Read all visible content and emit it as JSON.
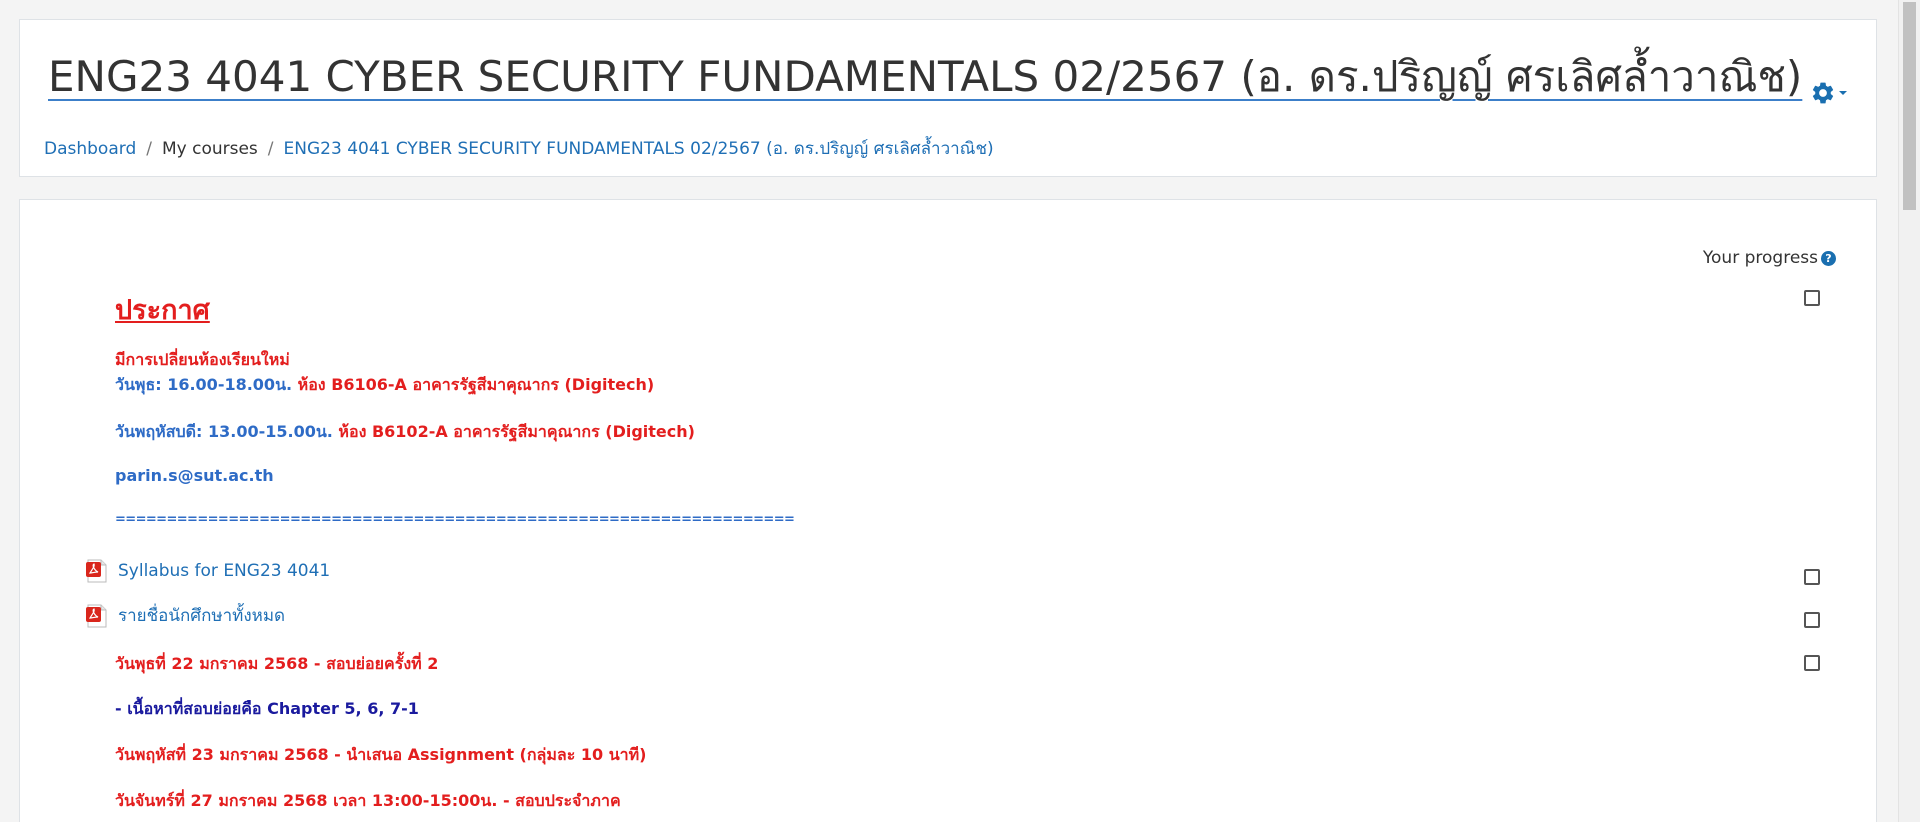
{
  "header": {
    "title": "ENG23 4041 CYBER SECURITY FUNDAMENTALS 02/2567 (อ. ดร.ปริญญ์ ศรเลิศล้ำวาณิช)",
    "settings_icon": "gear-icon"
  },
  "breadcrumb": [
    {
      "label": "Dashboard"
    },
    {
      "label": "My courses"
    },
    {
      "label": "ENG23 4041 CYBER SECURITY FUNDAMENTALS 02/2567 (อ. ดร.ปริญญ์ ศรเลิศล้ำวาณิช)"
    }
  ],
  "content": {
    "progress_label": "Your progress",
    "announcement": {
      "title": "ประกาศ",
      "room_change": "มีการเปลี่ยนห้องเรียนใหม่",
      "wed_day": "วันพุธ: 16.00-18.00น.",
      "wed_room": " ห้อง B6106-A อาคารรัฐสีมาคุณากร (Digitech)",
      "thu_day": "วันพฤหัสบดี: 13.00-15.00น.",
      "thu_room": " ห้อง B6102-A อาคารรัฐสีมาคุณากร (Digitech)",
      "email": "parin.s@sut.ac.th",
      "divider": "=================================================================="
    },
    "activities": [
      {
        "label": "Syllabus for ENG23 4041",
        "icon": "pdf-icon"
      },
      {
        "label": "รายชื่อนักศึกษาทั้งหมด",
        "icon": "pdf-icon"
      }
    ],
    "schedule": {
      "quiz": "วันพุธที่ 22 มกราคม 2568 - สอบย่อยครั้งที่ 2",
      "quiz_content": "- เนื้อหาที่สอบย่อยคือ Chapter 5, 6, 7-1",
      "assignment": "วันพฤหัสที่ 23 มกราคม 2568 - นำเสนอ Assignment (กลุ่มละ 10 นาที)",
      "exam": "วันจันทร์ที่ 27 มกราคม 2568 เวลา 13:00-15:00น. - สอบประจำภาค"
    }
  },
  "colors": {
    "accent": "#1f6fb5",
    "announcement_red": "#e31e1e",
    "announcement_blue": "#2e6bc6",
    "navy": "#1a1a9e",
    "pdf_red": "#d9261c"
  }
}
